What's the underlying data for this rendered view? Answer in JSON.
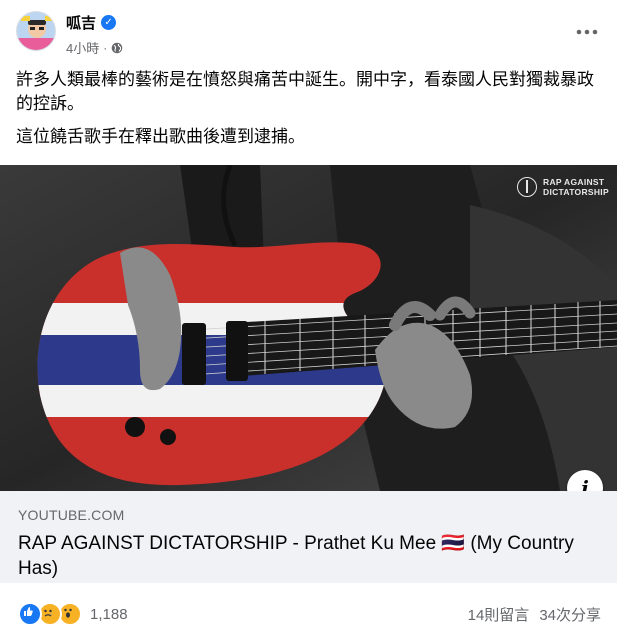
{
  "author": {
    "name": "呱吉",
    "time": "4小時",
    "separator": "·"
  },
  "post": {
    "paragraphs": [
      "許多人類最棒的藝術是在憤怒與痛苦中誕生。開中字，看泰國人民對獨裁暴政的控訴。",
      "這位饒舌歌手在釋出歌曲後遭到逮捕。"
    ]
  },
  "media": {
    "watermark_line1": "RAP AGAINST",
    "watermark_line2": "DICTATORSHIP",
    "info_label": "i"
  },
  "link": {
    "domain": "YOUTUBE.COM",
    "title": "RAP AGAINST DICTATORSHIP - Prathet Ku Mee 🇹🇭 (My Country Has)"
  },
  "footer": {
    "reaction_count": "1,188",
    "comments": "14則留言",
    "shares": "34次分享"
  },
  "colors": {
    "link_bg": "#f0f2f5",
    "secondary_text": "#65676b",
    "accent_blue": "#1877f2",
    "flag_red": "#c9302c",
    "flag_blue": "#2d3a8c"
  }
}
